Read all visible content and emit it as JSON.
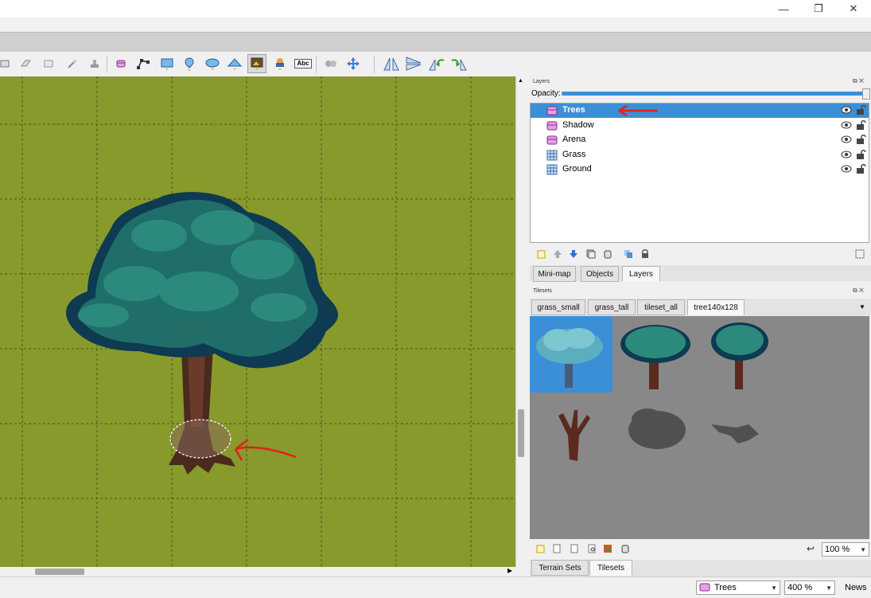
{
  "window": {
    "minimize_glyph": "—",
    "maximize_glyph": "❐",
    "close_glyph": "✕"
  },
  "toolbar": {
    "tools": [
      "rectangle-select-icon",
      "eraser-icon",
      "select-same-tile-icon",
      "magic-wand-icon",
      "stamp-fill-icon",
      "select-objects-icon",
      "edit-polygons-icon",
      "insert-rectangle-icon",
      "insert-point-icon",
      "insert-ellipse-icon",
      "insert-polygon-icon",
      "insert-tile-icon",
      "insert-template-icon",
      "insert-text-icon",
      "random-mode-icon",
      "move-icon",
      "flip-horizontal-icon",
      "flip-vertical-icon",
      "rotate-left-icon",
      "rotate-right-icon"
    ],
    "text_tool_label": "Abc"
  },
  "layers_panel": {
    "title": "Layers",
    "opacity_label": "Opacity:",
    "opacity_value": 1.0,
    "layers": [
      {
        "name": "Trees",
        "type": "object-layer-icon",
        "selected": true
      },
      {
        "name": "Shadow",
        "type": "object-layer-icon",
        "selected": false
      },
      {
        "name": "Arena",
        "type": "object-layer-icon",
        "selected": false
      },
      {
        "name": "Grass",
        "type": "tile-layer-icon",
        "selected": false
      },
      {
        "name": "Ground",
        "type": "tile-layer-icon",
        "selected": false
      }
    ],
    "tabs": [
      "Mini-map",
      "Objects",
      "Layers"
    ],
    "active_tab": "Layers"
  },
  "tilesets_panel": {
    "title": "Tilesets",
    "tabs": [
      "grass_small",
      "grass_tall",
      "tileset_all",
      "tree140x128"
    ],
    "active_tab": "tree140x128",
    "zoom": "100 %",
    "bottom_tabs": [
      "Terrain Sets",
      "Tilesets"
    ],
    "active_bottom_tab": "Tilesets"
  },
  "statusbar": {
    "current_layer": "Trees",
    "zoom": "400 %",
    "news_label": "News"
  },
  "colors": {
    "canvas_bg": "#879a2b",
    "selection": "#3b8fd6",
    "tileset_bg": "#888888",
    "annotation_arrow": "#e02020"
  }
}
